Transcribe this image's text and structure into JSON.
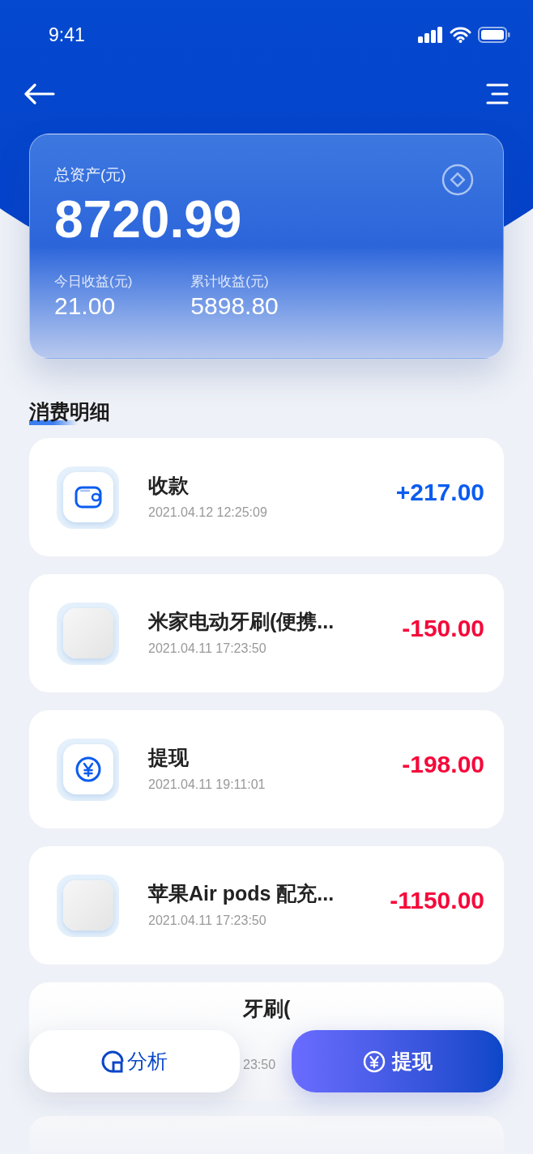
{
  "status_bar": {
    "time": "9:41"
  },
  "summary": {
    "label": "总资产(元)",
    "total": "8720.99",
    "stats": [
      {
        "label": "今日收益(元)",
        "value": "21.00"
      },
      {
        "label": "累计收益(元)",
        "value": "5898.80"
      }
    ]
  },
  "section_title": "消费明细",
  "transactions": [
    {
      "kind": "wallet",
      "title": "收款",
      "time": "2021.04.12 12:25:09",
      "amount": "+217.00",
      "color": "#0a5cf0"
    },
    {
      "kind": "photo",
      "title": "米家电动牙刷(便携...",
      "time": "2021.04.11 17:23:50",
      "amount": "-150.00",
      "color": "#f5093a"
    },
    {
      "kind": "yen",
      "title": "提现",
      "time": "2021.04.11 19:11:01",
      "amount": "-198.00",
      "color": "#f5093a"
    },
    {
      "kind": "photo",
      "title": "苹果Air pods 配充...",
      "time": "2021.04.11 17:23:50",
      "amount": "-1150.00",
      "color": "#f5093a"
    },
    {
      "kind": "partial",
      "title": "牙刷(",
      "time": "23:50"
    }
  ],
  "actions": [
    {
      "kind": "analysis",
      "label": "分析"
    },
    {
      "kind": "withdraw",
      "label": "提现"
    }
  ]
}
